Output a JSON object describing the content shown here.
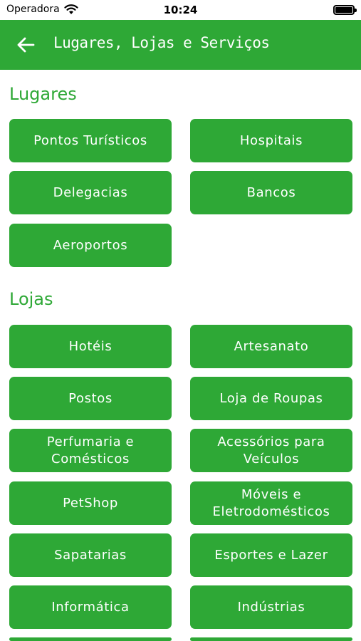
{
  "status_bar": {
    "carrier": "Operadora",
    "time": "10:24",
    "icons": [
      "wifi-icon",
      "battery-icon"
    ]
  },
  "app_bar": {
    "title": "Lugares, Lojas e Serviços",
    "back_icon": "arrow-left-icon"
  },
  "colors": {
    "primary": "#2ea836",
    "text_on_primary": "#ffffff",
    "background": "#ffffff"
  },
  "sections": [
    {
      "title": "Lugares",
      "items": [
        "Pontos Turísticos",
        "Hospitais",
        "Delegacias",
        "Bancos",
        "Aeroportos"
      ]
    },
    {
      "title": "Lojas",
      "items": [
        "Hotéis",
        "Artesanato",
        "Postos",
        "Loja de Roupas",
        "Perfumaria e Comésticos",
        "Acessórios para Veículos",
        "PetShop",
        "Móveis e Eletrodomésticos",
        "Sapatarias",
        "Esportes e Lazer",
        "Informática",
        "Indústrias",
        "",
        ""
      ]
    }
  ]
}
